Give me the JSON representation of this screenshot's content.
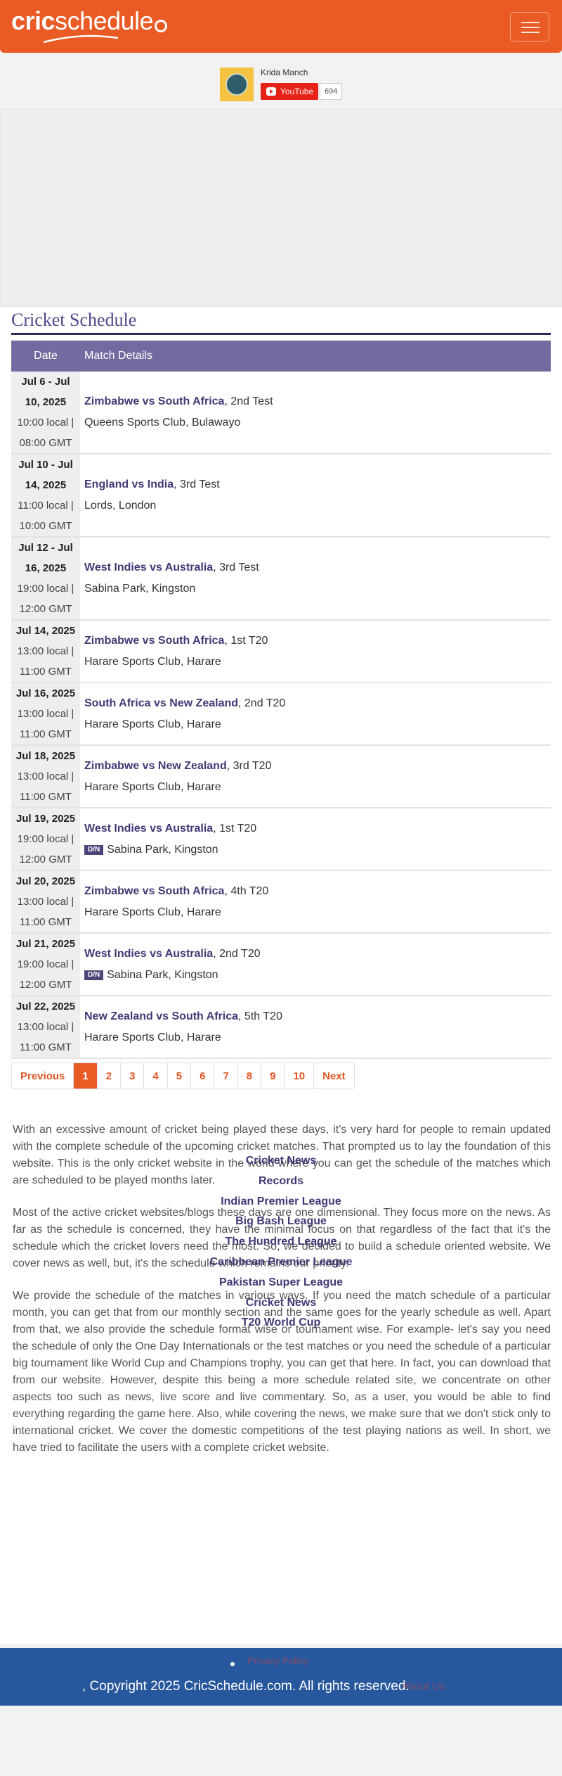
{
  "header": {
    "logo_part1": "cric",
    "logo_part2": "schedule"
  },
  "youtube": {
    "channel_name": "Krida Manch",
    "button_label": "YouTube",
    "subscriber_count": "694"
  },
  "schedule": {
    "title": "Cricket Schedule",
    "columns": [
      "Date",
      "Match Details"
    ],
    "rows": [
      {
        "date": "Jul 6 - Jul 10, 2025",
        "local": "10:00 local |",
        "gmt": "08:00 GMT",
        "match": "Zimbabwe vs South Africa",
        "type": ", 2nd Test",
        "venue": "Queens Sports Club, Bulawayo",
        "dn": false
      },
      {
        "date": "Jul 10 - Jul 14, 2025",
        "local": "11:00 local |",
        "gmt": "10:00 GMT",
        "match": "England vs India",
        "type": ", 3rd Test",
        "venue": "Lords, London",
        "dn": false
      },
      {
        "date": "Jul 12 - Jul 16, 2025",
        "local": "19:00 local |",
        "gmt": "12:00 GMT",
        "match": "West Indies vs Australia",
        "type": ", 3rd Test",
        "venue": "Sabina Park, Kingston",
        "dn": false
      },
      {
        "date": "Jul 14, 2025",
        "local": "13:00 local |",
        "gmt": "11:00 GMT",
        "match": "Zimbabwe vs South Africa",
        "type": ", 1st T20",
        "venue": "Harare Sports Club, Harare",
        "dn": false
      },
      {
        "date": "Jul 16, 2025",
        "local": "13:00 local |",
        "gmt": "11:00 GMT",
        "match": "South Africa vs New Zealand",
        "type": ", 2nd T20",
        "venue": "Harare Sports Club, Harare",
        "dn": false
      },
      {
        "date": "Jul 18, 2025",
        "local": "13:00 local |",
        "gmt": "11:00 GMT",
        "match": "Zimbabwe vs New Zealand",
        "type": ", 3rd T20",
        "venue": "Harare Sports Club, Harare",
        "dn": false
      },
      {
        "date": "Jul 19, 2025",
        "local": "19:00 local |",
        "gmt": "12:00 GMT",
        "match": "West Indies vs Australia",
        "type": ", 1st T20",
        "venue": "Sabina Park, Kingston",
        "dn": true
      },
      {
        "date": "Jul 20, 2025",
        "local": "13:00 local |",
        "gmt": "11:00 GMT",
        "match": "Zimbabwe vs South Africa",
        "type": ", 4th T20",
        "venue": "Harare Sports Club, Harare",
        "dn": false
      },
      {
        "date": "Jul 21, 2025",
        "local": "19:00 local |",
        "gmt": "12:00 GMT",
        "match": "West Indies vs Australia",
        "type": ", 2nd T20",
        "venue": "Sabina Park, Kingston",
        "dn": true
      },
      {
        "date": "Jul 22, 2025",
        "local": "13:00 local |",
        "gmt": "11:00 GMT",
        "match": "New Zealand vs South Africa",
        "type": ", 5th T20",
        "venue": "Harare Sports Club, Harare",
        "dn": false
      }
    ],
    "dn_label": "D/N"
  },
  "pagination": {
    "previous": "Previous",
    "pages": [
      "1",
      "2",
      "3",
      "4",
      "5",
      "6",
      "7",
      "8",
      "9",
      "10"
    ],
    "active": "1",
    "next": "Next"
  },
  "about": {
    "paragraphs": [
      "With an excessive amount of cricket being played these days, it's very hard for people to remain updated with the complete schedule of the upcoming cricket matches. That prompted us to lay the foundation of this website. This is the only cricket website in the world where you can get the schedule of the matches which are scheduled to be played months later.",
      "Most of the active cricket websites/blogs these days are one dimensional. They focus more on the news. As far as the schedule is concerned, they have the minimal focus on that regardless of the fact that it's the schedule which the cricket lovers need the most. So, we decided to build a schedule oriented website. We cover news as well, but, it's the schedule which remains our priority.",
      "We provide the schedule of the matches in various ways. If you need the match schedule of a particular month, you can get that from our monthly section and the same goes for the yearly schedule as well. Apart from that, we also provide the schedule format wise or tournament wise. For example- let's say you need the schedule of only the One Day Internationals or the test matches or you need the schedule of a particular big tournament like World Cup and Champions trophy, you can get that here. In fact, you can download that from our website. However, despite this being a more schedule related site, we concentrate on other aspects too such as news, live score and live commentary. So, as a user, you would be able to find everything regarding the game here. Also, while covering the news, we make sure that we don't stick only to international cricket. We cover the domestic competitions of the test playing nations as well. In short, we have tried to facilitate the users with a complete cricket website."
    ]
  },
  "links": [
    "Cricket News",
    "Records",
    "Indian Premier League",
    "Big Bash League",
    "The Hundred League",
    "Caribbean Premier League",
    "Pakistan Super League",
    "Cricket News",
    "T20 World Cup"
  ],
  "footer": {
    "privacy": "Privacy Policy",
    "copyright": ", Copyright 2025 CricSchedule.com. All rights reserved.",
    "powered": "About Us"
  },
  "colors": {
    "brand": "#ea5a24",
    "table_header": "#736b9f",
    "link": "#403a75",
    "footer": "#27579c"
  }
}
